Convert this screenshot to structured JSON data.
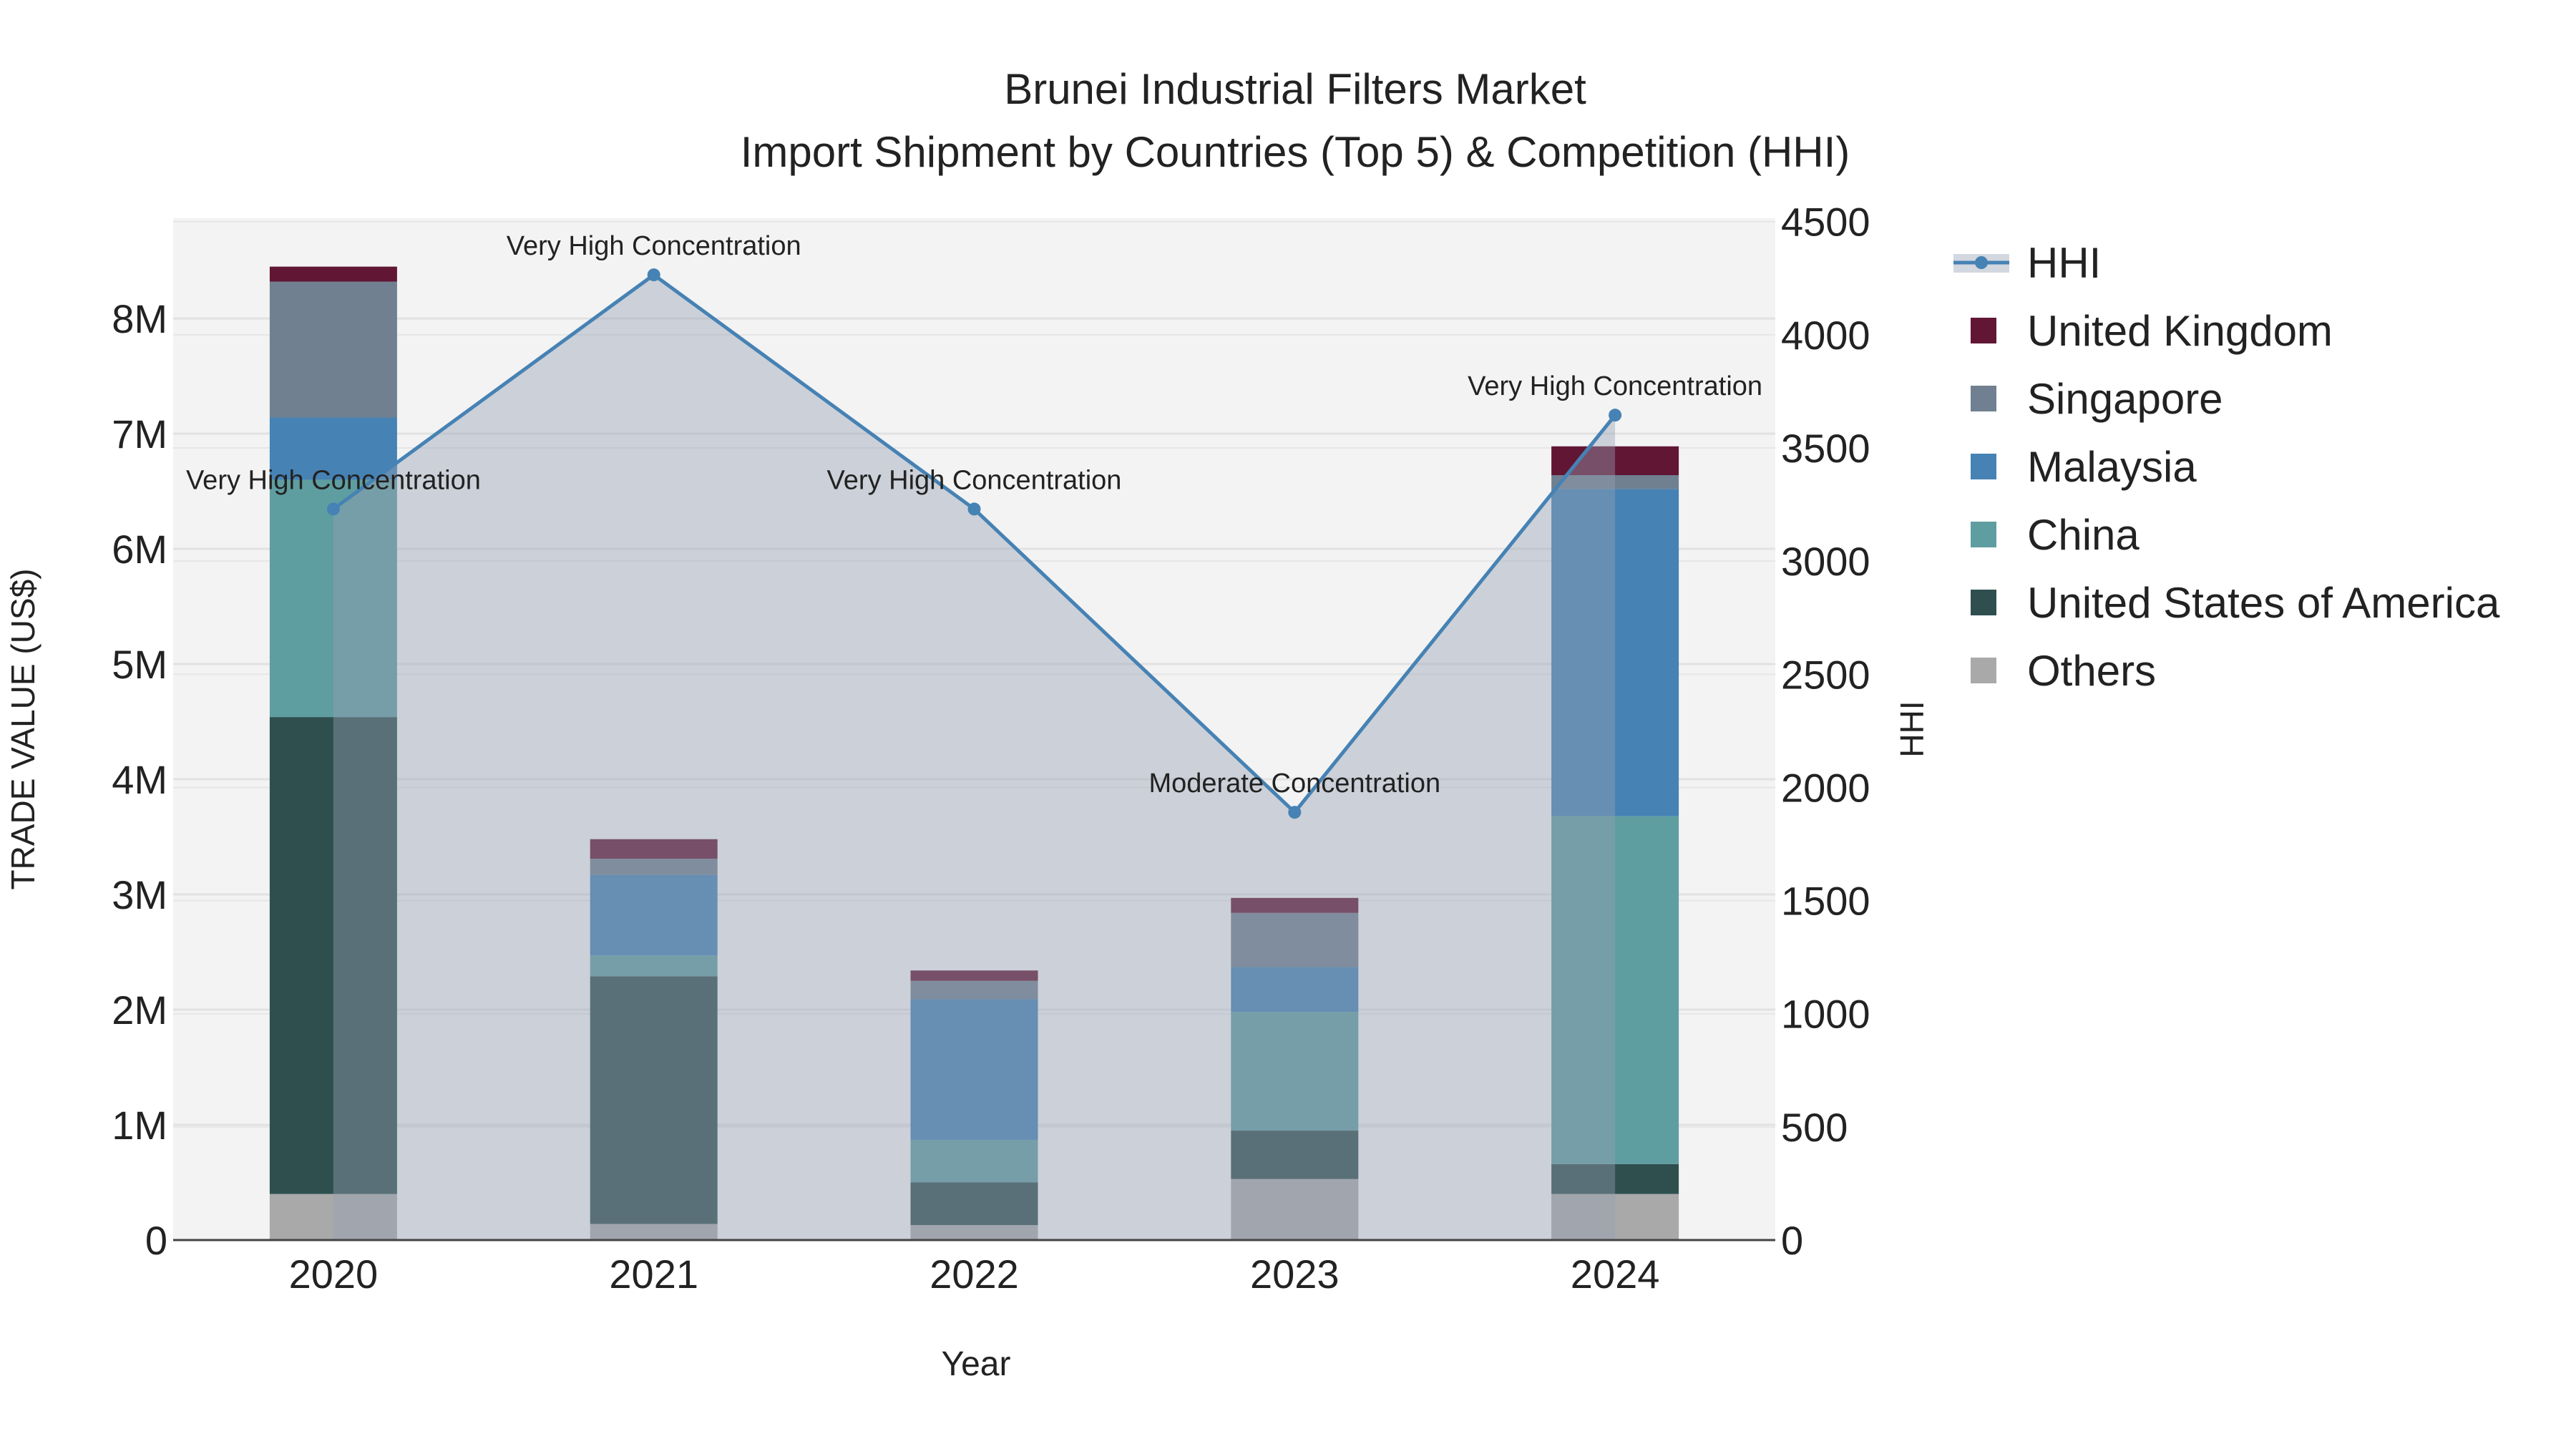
{
  "chart_data": {
    "type": "bar",
    "title": "Brunei Industrial Filters Market",
    "subtitle": "Import Shipment by Countries (Top 5) & Competition (HHI)",
    "xlabel": "Year",
    "ylabel": "TRADE VALUE (US$)",
    "y2label": "HHI",
    "categories": [
      "2020",
      "2021",
      "2022",
      "2023",
      "2024"
    ],
    "ylim": [
      0,
      8870000
    ],
    "y2lim": [
      0,
      4515
    ],
    "yticks": [
      0,
      1000000,
      2000000,
      3000000,
      4000000,
      5000000,
      6000000,
      7000000,
      8000000
    ],
    "ytick_labels": [
      "0",
      "1M",
      "2M",
      "3M",
      "4M",
      "5M",
      "6M",
      "7M",
      "8M"
    ],
    "y2ticks": [
      0,
      500,
      1000,
      1500,
      2000,
      2500,
      3000,
      3500,
      4000,
      4500
    ],
    "y2tick_labels": [
      "0",
      "500",
      "1000",
      "1500",
      "2000",
      "2500",
      "3000",
      "3500",
      "4000",
      "4500"
    ],
    "grid": true,
    "legend_position": "right",
    "series": [
      {
        "name": "Others",
        "color": "#a9a9a9",
        "values": [
          400000,
          140000,
          130000,
          530000,
          400000
        ]
      },
      {
        "name": "United States of America",
        "color": "#2f4f4f",
        "values": [
          4140000,
          2150000,
          370000,
          420000,
          260000
        ]
      },
      {
        "name": "China",
        "color": "#5f9ea0",
        "values": [
          2060000,
          180000,
          370000,
          1030000,
          3020000
        ]
      },
      {
        "name": "Malaysia",
        "color": "#4682b4",
        "values": [
          540000,
          700000,
          1220000,
          390000,
          2840000
        ]
      },
      {
        "name": "Singapore",
        "color": "#708090",
        "values": [
          1180000,
          140000,
          160000,
          470000,
          120000
        ]
      },
      {
        "name": "United Kingdom",
        "color": "#611634",
        "values": [
          130000,
          170000,
          90000,
          130000,
          250000
        ]
      }
    ],
    "hhi": {
      "name": "HHI",
      "color": "#4682b4",
      "values": [
        3230,
        4265,
        3230,
        1890,
        3645
      ],
      "annotations": [
        "Very High Concentration",
        "Very High Concentration",
        "Very High Concentration",
        "Moderate Concentration",
        "Very High Concentration"
      ]
    },
    "legend_order": [
      "HHI",
      "United Kingdom",
      "Singapore",
      "Malaysia",
      "China",
      "United States of America",
      "Others"
    ]
  }
}
